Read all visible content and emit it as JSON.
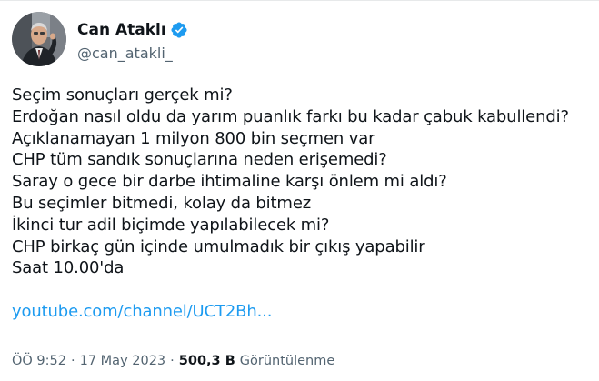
{
  "author": {
    "display_name": "Can Ataklı",
    "handle": "@can_atakli_",
    "verified": true,
    "verified_color": "#1d9bf0"
  },
  "tweet": {
    "lines": [
      "Seçim sonuçları gerçek mi?",
      "Erdoğan nasıl oldu da yarım puanlık farkı bu kadar çabuk kabullendi?",
      "Açıklanamayan 1 milyon 800 bin seçmen var",
      "CHP tüm sandık sonuçlarına neden erişemedi?",
      "Saray o gece bir darbe ihtimaline karşı önlem mi aldı?",
      "Bu seçimler bitmedi, kolay da bitmez",
      "İkinci tur adil biçimde yapılabilecek mi?",
      "CHP birkaç gün içinde umulmadık bir çıkış yapabilir",
      "Saat 10.00'da"
    ],
    "link_text": "youtube.com/channel/UCT2Bh...",
    "link_color": "#1d9bf0"
  },
  "meta": {
    "time": "ÖÖ 9:52",
    "separator": "·",
    "date": "17 May 2023",
    "views_count": "500,3 B",
    "views_label": "Görüntülenme"
  }
}
